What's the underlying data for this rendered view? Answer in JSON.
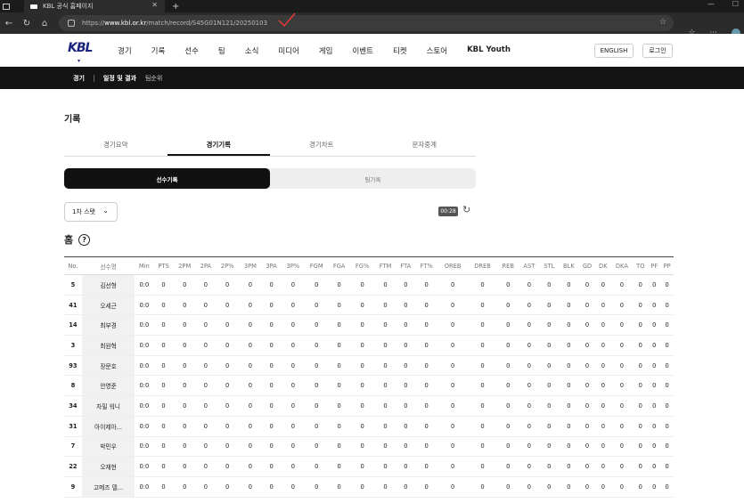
{
  "browser": {
    "tab_title": "KBL 공식 홈페이지",
    "url_prefix": "https://",
    "url_host": "www.kbl.or.kr",
    "url_path": "/match/record/S45G01N121/20250103",
    "annotation_color": "#e53935"
  },
  "header": {
    "logo": "KBL",
    "nav": [
      "경기",
      "기록",
      "선수",
      "팀",
      "소식",
      "미디어",
      "게임",
      "이벤트",
      "티켓",
      "스토어",
      "KBL Youth"
    ],
    "lang_label": "ENGLISH",
    "login_label": "로그인"
  },
  "subnav": {
    "section": "경기",
    "active": "일정 및 결과",
    "other": "팀순위"
  },
  "page": {
    "title": "기록",
    "tabs": [
      "경기요약",
      "경기기록",
      "경기차트",
      "문자중계"
    ],
    "active_tab": "경기기록",
    "segments": [
      "선수기록",
      "팀기록"
    ],
    "active_segment": "선수기록",
    "quarter_select": "1차 스탯",
    "timer": "00:28",
    "team_title": "홈",
    "help_icon": "?"
  },
  "table": {
    "columns": [
      "No.",
      "선수명",
      "Min",
      "PTS",
      "2PM",
      "2PA",
      "2P%",
      "3PM",
      "3PA",
      "3P%",
      "FGM",
      "FGA",
      "FG%",
      "FTM",
      "FTA",
      "FT%",
      "OREB",
      "DREB",
      "REB",
      "AST",
      "STL",
      "BLK",
      "GD",
      "DK",
      "DKA",
      "TO",
      "PF",
      "PP"
    ],
    "rows": [
      {
        "no": "5",
        "name": "김선형",
        "min": "0:0"
      },
      {
        "no": "41",
        "name": "오세근",
        "min": "0:0"
      },
      {
        "no": "14",
        "name": "최부경",
        "min": "0:0"
      },
      {
        "no": "3",
        "name": "최원혁",
        "min": "0:0"
      },
      {
        "no": "93",
        "name": "장문호",
        "min": "0:0"
      },
      {
        "no": "8",
        "name": "안영준",
        "min": "0:0"
      },
      {
        "no": "34",
        "name": "자밀 워니",
        "min": "0:0"
      },
      {
        "no": "31",
        "name": "아이제아...",
        "min": "0:0"
      },
      {
        "no": "7",
        "name": "박민우",
        "min": "0:0"
      },
      {
        "no": "22",
        "name": "오재현",
        "min": "0:0"
      },
      {
        "no": "9",
        "name": "고메즈 델...",
        "min": "0:0"
      }
    ],
    "zero": "0"
  }
}
